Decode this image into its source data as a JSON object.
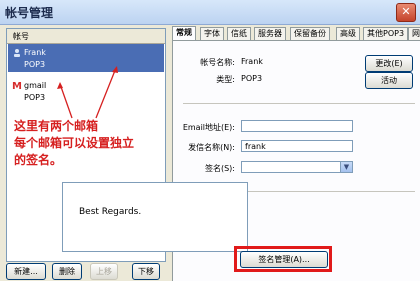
{
  "window": {
    "title": "帐号管理",
    "close_glyph": "✕"
  },
  "left": {
    "header": "帐号",
    "accounts": [
      {
        "name": "Frank",
        "type": "POP3",
        "icon": "user-icon"
      },
      {
        "name": "gmail",
        "type": "POP3",
        "icon": "gmail-icon"
      }
    ],
    "annotation_lines": [
      "这里有两个邮箱",
      "每个邮箱可以设置独立",
      "的签名。"
    ],
    "buttons": {
      "new": "新建...",
      "delete": "删除",
      "move_up": "上移",
      "move_down": "下移"
    }
  },
  "tabs": [
    "常规",
    "字体",
    "信纸",
    "服务器",
    "保留备份",
    "高级",
    "其他POP3",
    "网"
  ],
  "general": {
    "account_name_label": "帐号名称:",
    "account_name_value": "Frank",
    "type_label": "类型:",
    "type_value": "POP3",
    "change_button": "更改(E)",
    "activate_button": "活动",
    "email_label": "Email地址(E):",
    "email_value": "",
    "sender_label": "发信名称(N):",
    "sender_value": "frank",
    "signature_label": "签名(S):",
    "signature_selected": "",
    "signature_text": "Best Regards.",
    "manage_signature_button": "签名管理(A)..."
  },
  "colors": {
    "annotation": "#d62020",
    "selection": "#4a6db4",
    "highlight_box": "#e11a1a"
  }
}
